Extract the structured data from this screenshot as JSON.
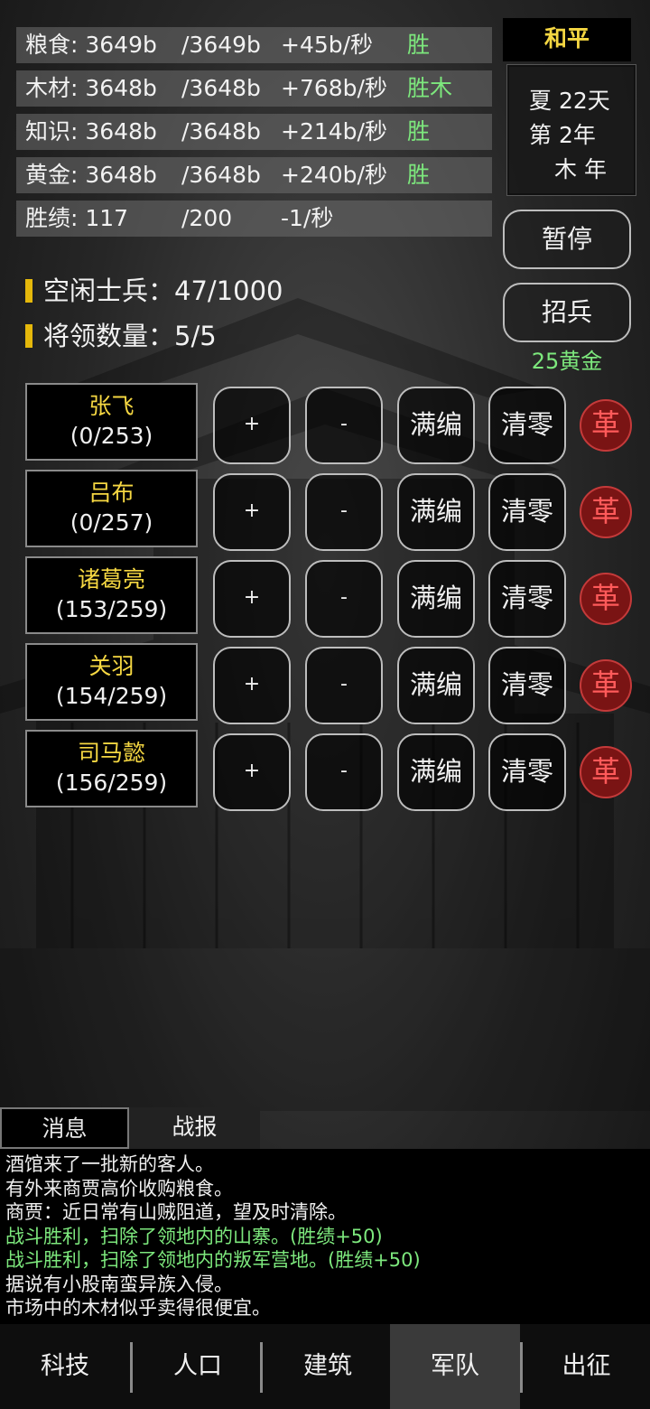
{
  "resources": [
    {
      "name": "粮食: 3649b",
      "cap": "/3649b",
      "rate": "+45b/秒",
      "tag": "胜"
    },
    {
      "name": "木材: 3648b",
      "cap": "/3648b",
      "rate": "+768b/秒",
      "tag": "胜木"
    },
    {
      "name": "知识: 3648b",
      "cap": "/3648b",
      "rate": "+214b/秒",
      "tag": "胜"
    },
    {
      "name": "黄金: 3648b",
      "cap": "/3648b",
      "rate": "+240b/秒",
      "tag": "胜"
    },
    {
      "name": "胜绩: 117",
      "cap": "/200",
      "rate": "-1/秒",
      "tag": ""
    }
  ],
  "status": {
    "peace": "和平"
  },
  "date": {
    "season_day": "夏 22天",
    "year": "第 2年",
    "element_year": "木 年"
  },
  "controls": {
    "pause_label": "暂停",
    "recruit_label": "招兵",
    "recruit_cost": "25黄金"
  },
  "army": {
    "idle_soldiers": "空闲士兵：47/1000",
    "general_count": "将领数量：5/5"
  },
  "generals": [
    {
      "name": "张飞",
      "troops": "(0/253)"
    },
    {
      "name": "吕布",
      "troops": "(0/257)"
    },
    {
      "name": "诸葛亮",
      "troops": "(153/259)"
    },
    {
      "name": "关羽",
      "troops": "(154/259)"
    },
    {
      "name": "司马懿",
      "troops": "(156/259)"
    }
  ],
  "general_buttons": {
    "add": "+",
    "remove": "-",
    "fill": "满编",
    "clear": "清零",
    "dismiss": "革"
  },
  "log_tabs": {
    "messages": "消息",
    "reports": "战报"
  },
  "log_lines": [
    {
      "text": "酒馆来了一批新的客人。",
      "highlight": false
    },
    {
      "text": "有外来商贾高价收购粮食。",
      "highlight": false
    },
    {
      "text": "商贾：近日常有山贼阻道，望及时清除。",
      "highlight": false
    },
    {
      "text": "战斗胜利，扫除了领地内的山寨。(胜绩+50)",
      "highlight": true
    },
    {
      "text": "战斗胜利，扫除了领地内的叛军营地。(胜绩+50)",
      "highlight": true
    },
    {
      "text": "据说有小股南蛮异族入侵。",
      "highlight": false
    },
    {
      "text": "市场中的木材似乎卖得很便宜。",
      "highlight": false
    }
  ],
  "nav": [
    "科技",
    "人口",
    "建筑",
    "军队",
    "出征"
  ],
  "nav_active": "军队",
  "colors": {
    "positive": "#7de87d",
    "gold": "#f5d742",
    "accent_bar": "#e5b80b",
    "danger": "#ff5a5a"
  }
}
